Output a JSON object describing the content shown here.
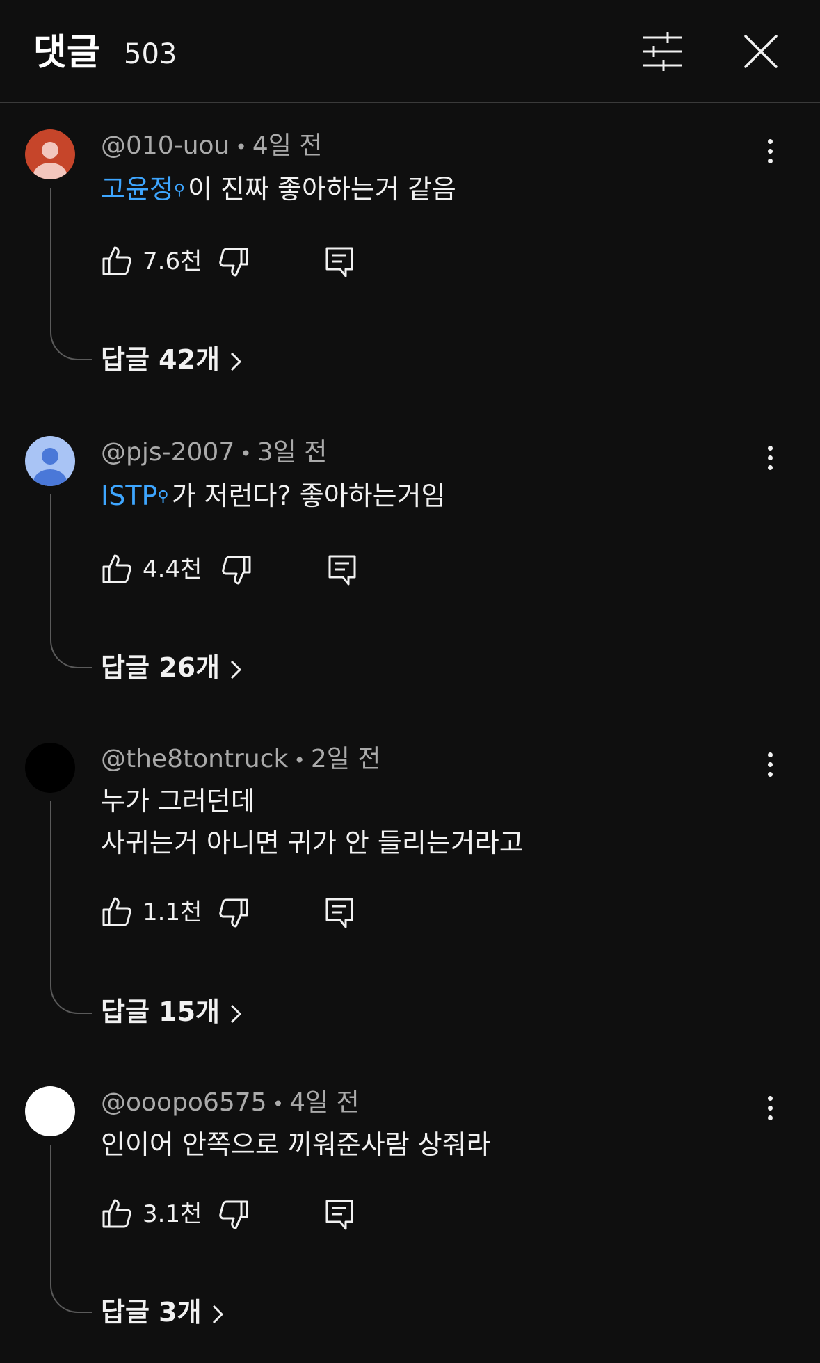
{
  "header": {
    "title": "댓글",
    "count": "503"
  },
  "icons": {
    "filter": "sliders-icon",
    "close": "close-icon",
    "more": "more-vert-icon",
    "like": "thumb-up-icon",
    "dislike": "thumb-down-icon",
    "reply": "reply-comment-icon",
    "chevron": "chevron-right-icon",
    "avatar": "person-avatar-icon"
  },
  "colors": {
    "background": "#0f0f0f",
    "link": "#3ea6ff",
    "muted": "#aaaaaa"
  },
  "comments": [
    {
      "author": "@010-uou",
      "time": "4일 전",
      "link_text": "고윤정",
      "text": "이 진짜 좋아하는거 같음",
      "likes": "7.6천",
      "replies": "답글 42개",
      "avatar_color": "#c6452a"
    },
    {
      "author": "@pjs-2007",
      "time": "3일 전",
      "link_text": "ISTP",
      "text": "가 저런다? 좋아하는거임",
      "likes": "4.4천",
      "replies": "답글 26개",
      "avatar_color": "#a9c4f5"
    },
    {
      "author": "@the8tontruck",
      "time": "2일 전",
      "text_line1": "누가 그러던데",
      "text_line2": "사귀는거 아니면 귀가 안 들리는거라고",
      "likes": "1.1천",
      "replies": "답글 15개",
      "avatar_color": "#000000"
    },
    {
      "author": "@ooopo6575",
      "time": "4일 전",
      "text": "인이어 안쪽으로 끼워준사람 상줘라",
      "likes": "3.1천",
      "replies": "답글 3개",
      "avatar_color": "#ffffff"
    }
  ]
}
